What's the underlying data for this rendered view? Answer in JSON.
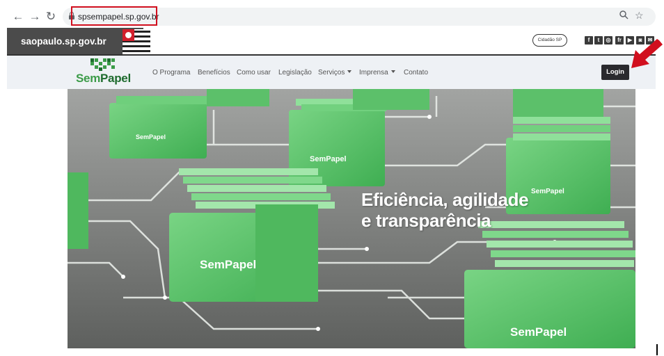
{
  "browser": {
    "url": "spsempapel.sp.gov.br",
    "icons": [
      "back-arrow-icon",
      "forward-arrow-icon",
      "reload-icon",
      "lock-icon",
      "zoom-icon",
      "star-icon"
    ]
  },
  "gov_bar": {
    "site": "saopaulo.sp.gov.br",
    "cidadao": "Cidadão SP",
    "social": [
      "f",
      "t",
      "◎",
      "fr",
      "▶",
      "◙",
      "✉"
    ]
  },
  "site_nav": {
    "logo_part1": "Sem",
    "logo_part2": "Papel",
    "items": [
      {
        "label": "O Programa"
      },
      {
        "label": "Benefícios"
      },
      {
        "label": "Como usar"
      },
      {
        "label": "Legislação"
      },
      {
        "label": "Serviços"
      },
      {
        "label": "Imprensa"
      },
      {
        "label": "Contato"
      }
    ],
    "login": "Login"
  },
  "hero": {
    "line1": "Eficiência, agilidade",
    "line2": "e transparência",
    "folder_brand": "SemPapel"
  },
  "colors": {
    "annotation_red": "#d10f1e",
    "brand_green": "#3b9b48",
    "folder_green": "#5bc46a"
  }
}
